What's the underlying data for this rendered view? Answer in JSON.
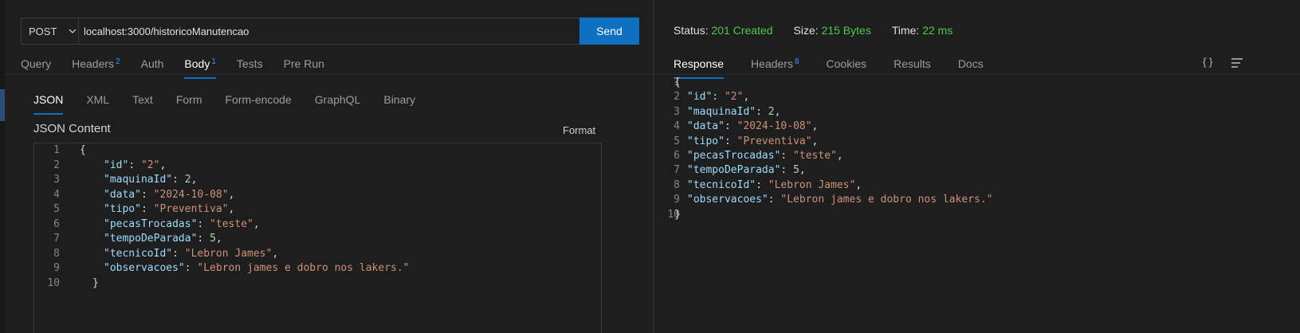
{
  "request": {
    "method": "POST",
    "url": "localhost:3000/historicoManutencao",
    "send_label": "Send",
    "tabs": [
      {
        "label": "Query",
        "badge": ""
      },
      {
        "label": "Headers",
        "badge": "2"
      },
      {
        "label": "Auth",
        "badge": ""
      },
      {
        "label": "Body",
        "badge": "1"
      },
      {
        "label": "Tests",
        "badge": ""
      },
      {
        "label": "Pre Run",
        "badge": ""
      }
    ],
    "active_tab": "Body",
    "body_tabs": [
      "JSON",
      "XML",
      "Text",
      "Form",
      "Form-encode",
      "GraphQL",
      "Binary"
    ],
    "active_body_tab": "JSON",
    "content_label": "JSON Content",
    "format_label": "Format",
    "line_numbers": [
      "1",
      "2",
      "3",
      "4",
      "5",
      "6",
      "7",
      "8",
      "9",
      "10"
    ]
  },
  "response": {
    "status_label": "Status:",
    "status_value": "201 Created",
    "size_label": "Size:",
    "size_value": "215 Bytes",
    "time_label": "Time:",
    "time_value": "22 ms",
    "tabs": [
      {
        "label": "Response",
        "badge": ""
      },
      {
        "label": "Headers",
        "badge": "8"
      },
      {
        "label": "Cookies",
        "badge": ""
      },
      {
        "label": "Results",
        "badge": ""
      },
      {
        "label": "Docs",
        "badge": ""
      }
    ],
    "active_tab": "Response",
    "braces_icon": "{ }",
    "line_numbers": [
      "1",
      "2",
      "3",
      "4",
      "5",
      "6",
      "7",
      "8",
      "9",
      "10"
    ]
  },
  "body_json": {
    "open": "{",
    "close": "}",
    "entries": [
      {
        "key": "\"id\"",
        "value": "\"2\"",
        "kind": "string",
        "comma": ","
      },
      {
        "key": "\"maquinaId\"",
        "value": "2",
        "kind": "number",
        "comma": ","
      },
      {
        "key": "\"data\"",
        "value": "\"2024-10-08\"",
        "kind": "string",
        "comma": ","
      },
      {
        "key": "\"tipo\"",
        "value": "\"Preventiva\"",
        "kind": "string",
        "comma": ","
      },
      {
        "key": "\"pecasTrocadas\"",
        "value": "\"teste\"",
        "kind": "string",
        "comma": ","
      },
      {
        "key": "\"tempoDeParada\"",
        "value": "5",
        "kind": "number",
        "comma": ","
      },
      {
        "key": "\"tecnicoId\"",
        "value": "\"Lebron James\"",
        "kind": "string",
        "comma": ","
      },
      {
        "key": "\"observacoes\"",
        "value": "\"Lebron james e dobro nos lakers.\"",
        "kind": "string",
        "comma": ""
      }
    ]
  },
  "colors": {
    "send_button": "#0e70c0",
    "active_tab_underline": "#0e70c0",
    "status_ok": "#4ec94e",
    "json_key": "#9cdcfe",
    "json_string": "#ce9178",
    "json_number": "#b5cea8"
  }
}
